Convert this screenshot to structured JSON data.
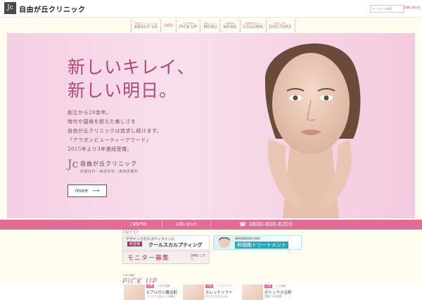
{
  "header": {
    "logo_text": "Jc",
    "brand": "自由が丘クリニック",
    "search_placeholder": "キーワード検索",
    "contact": "お問い合わせ"
  },
  "nav": {
    "items": [
      {
        "sub": "自由が丘クリニックとは",
        "label": "ABOUT US"
      },
      {
        "sub": "",
        "label": "info"
      },
      {
        "sub": "人気の施術",
        "label": "PICK UP"
      },
      {
        "sub": "施術メニュー",
        "label": "MENU"
      },
      {
        "sub": "新着情報",
        "label": "NEWS"
      },
      {
        "sub": "医師監修コラム",
        "label": "COLUMN"
      },
      {
        "sub": "医師のご紹介",
        "label": "DOCTORS"
      }
    ]
  },
  "hero": {
    "title": "新しいキレイ、\n新しい明日。",
    "lines": [
      "創立から20余年。",
      "時代や国境を超えた美しさを",
      "自由が丘クリニックは追求し続けます。",
      "『アラガンビューティーアワード』",
      "2015年より3年連続受賞。"
    ],
    "clinic_name": "自由が丘クリニック",
    "clinic_sub": "形成外科・美容外科・美容皮膚科",
    "more_label": "more",
    "arrow": "⟶"
  },
  "bar": {
    "reserve": "ご来院予約",
    "inquiry": "お問い合わせ",
    "phone_icon": "☎",
    "phone": "0800-808-8200"
  },
  "info": {
    "heading": "INFO"
  },
  "banners": {
    "b1_top": "デザインされたボディラインに",
    "b1_badge": "新登場",
    "b1_main": "クールスカルプティング",
    "b2_top": "最新医療技術の施術",
    "b2_main": "幹細胞トリートメント",
    "b3_main": "モニター募集",
    "b3_side": "詳細は こちら"
  },
  "pickup": {
    "sub": "人気の施術",
    "heading": "PICK UP",
    "items": [
      {
        "tag": "人気",
        "cat": "たるみ治療",
        "title": "ヒアルロン酸注射",
        "desc": "ふっくらと若々しい印象に"
      },
      {
        "tag": "人気",
        "cat": "リフトアップ",
        "title": "スレッドリフト",
        "desc": "切らずに引き上げる"
      },
      {
        "tag": "人気",
        "cat": "しわ治療",
        "title": "ボトックス注射",
        "desc": "表情じわを改善"
      }
    ]
  },
  "colors": {
    "accent": "#e36b94",
    "hero_title": "#b0487a",
    "page_bg": "#fffdf0"
  }
}
